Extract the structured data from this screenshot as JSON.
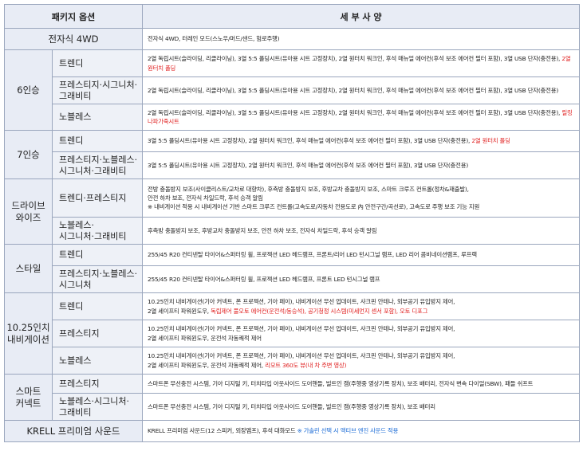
{
  "header": {
    "col1": "패키지 옵션",
    "col2": "세 부 사 양"
  },
  "rows": {
    "awd": {
      "cat": "전자식 4WD",
      "desc": "전자식 4WD, 터레인 모드(스노우/머드/샌드, 험로주행)"
    },
    "six": {
      "cat": "6인승",
      "trendy": {
        "name": "트렌디",
        "desc": "2열 독립시트(슬라이딩, 리클라이닝), 3열 5:5 폴딩시트(유아용 시트 고정장치), 2열 원터치 워크인, 후석 매뉴얼 에어컨(후석 보조 에어컨 필터 포함), 3열 USB 단자(충전용), ",
        "desc_red": "2열 원터치 폴딩"
      },
      "prestige": {
        "name1": "프레스티지·시그니처·",
        "name2": "그래비티",
        "desc": "2열 독립시트(슬라이딩, 리클라이닝), 3열 5:5 폴딩시트(유아용 시트 고정장치), 2열 원터치 워크인, 후석 매뉴얼 에어컨(후석 보조 에어컨 필터 포함), 3열 USB 단자(충전용)"
      },
      "noblesse": {
        "name": "노블레스",
        "desc": "2열 독립시트(슬라이딩, 리클라이닝), 3열 5:5 폴딩시트(유아용 시트 고정장치), 2열 원터치 워크인, 후석 매뉴얼 에어컨(후석 보조 에어컨 필터 포함), 3열 USB 단자(충전용), ",
        "desc_red": "릴링 나파가죽시트"
      }
    },
    "seven": {
      "cat": "7인승",
      "trendy": {
        "name": "트렌디",
        "desc": "3열 5:5 폴딩시트(유아용 시트 고정장치), 2열 원터치 워크인, 후석 매뉴얼 에어컨(후석 보조 에어컨 필터 포함), 3열 USB 단자(충전용), ",
        "desc_red": "2열 원터치 폴딩"
      },
      "prestige": {
        "name1": "프레스티지·노블레스·",
        "name2": "시그니처·그래비티",
        "desc": "3열 5:5 폴딩시트(유아용 시트 고정장치), 2열 원터치 워크인, 후석 매뉴얼 에어컨(후석 보조 에어컨 필터 포함), 3열 USB 단자(충전용)"
      }
    },
    "drivewise": {
      "cat1": "드라이브",
      "cat2": "와이즈",
      "trendy": {
        "name": "트렌디·프레스티지",
        "line1": "전방 충돌방지 보조(사이클리스트/교차로 대향차), 후측방 충돌방지 보조, 후방교차 충돌방지 보조, 스마트 크루즈 컨트롤(정차&재출발),",
        "line2": "안전 하차 보조, 전자식 차일드락, 후석 승객 알림",
        "line3": "※ 내비게이션 적용 시 내비게이션 기반 스마트 크루즈 컨트롤(고속도로/자동차 전용도로 內 안전구간/곡선로), 고속도로 주행 보조 기능 지원"
      },
      "noblesse": {
        "name1": "노블레스·",
        "name2": "시그니처·그래비티",
        "desc": "후측방 충돌방지 보조, 후방교차 충돌방지 보조, 안전 하차 보조, 전자식 차일드락, 후석 승객 알림"
      }
    },
    "style": {
      "cat": "스타일",
      "trendy": {
        "name": "트렌디",
        "desc": "255/45 R20 컨티넨탈 타이어&스퍼터링 휠, 프로젝션 LED 헤드램프, 프론트/리어 LED 턴시그널 램프, LED 리어 콤비네이션램프, 루프랙"
      },
      "prestige": {
        "name1": "프레스티지·노블레스·",
        "name2": "시그니처",
        "desc": "255/45 R20 컨티넨탈 타이어&스퍼터링 휠, 프로젝션 LED 헤드램프, 프론트 LED 턴시그널 램프"
      }
    },
    "navi": {
      "cat1": "10.25인치",
      "cat2": "내비게이션",
      "trendy": {
        "name": "트렌디",
        "line1": "10.25인치 내비게이션(기아 커넥트, 폰 프로젝션, 기아 페이), 내비게이션 무선 업데이트, 샤크핀 안테나, 외부공기 유입방지 제어,",
        "line2": "2열 세이프티 파워윈도우, ",
        "line2_red": "독립제어 풀오토 에어컨(운전석/동승석), 공기청정 시스템(미세먼지 센서 포함), 오토 디포그"
      },
      "prestige": {
        "name": "프레스티지",
        "line1": "10.25인치 내비게이션(기아 커넥트, 폰 프로젝션, 기아 페이), 내비게이션 무선 업데이트, 샤크핀 안테나, 외부공기 유입방지 제어,",
        "line2": "2열 세이프티 파워윈도우, 운전석 자동쾌적 제어"
      },
      "noblesse": {
        "name": "노블레스",
        "line1": "10.25인치 내비게이션(기아 커넥트, 폰 프로젝션, 기아 페이), 내비게이션 무선 업데이트, 샤크핀 안테나, 외부공기 유입방지 제어,",
        "line2": "2열 세이프티 파워윈도우, 운전석 자동쾌적 제어, ",
        "line2_red": "리모트 360도 뷰(내 차 주변 영상)"
      }
    },
    "connect": {
      "cat1": "스마트",
      "cat2": "커넥트",
      "prestige": {
        "name": "프레스티지",
        "desc": "스마트폰 무선충전 시스템, 기아 디지털 키, 터치타입 아웃사이드 도어핸들, 빌트인 캠(주행중 영상기록 장치), 보조 배터리, 전자식 변속 다이얼(SBW), 패들 쉬프트"
      },
      "noblesse": {
        "name1": "노블레스·시그니처·",
        "name2": "그래비티",
        "desc": "스마트폰 무선충전 시스템, 기아 디지털 키, 터치타입 아웃사이드 도어핸들, 빌트인 캠(주행중 영상기록 장치), 보조 배터리"
      }
    },
    "krell": {
      "cat": "KRELL 프리미엄 사운드",
      "desc": "KRELL 프리미엄 사운드(12 스피커, 외장앰프), 후석 대화모드 ",
      "desc_blue": "※ 가솔린 선택 시 액티브 엔진 사운드 적용"
    }
  }
}
